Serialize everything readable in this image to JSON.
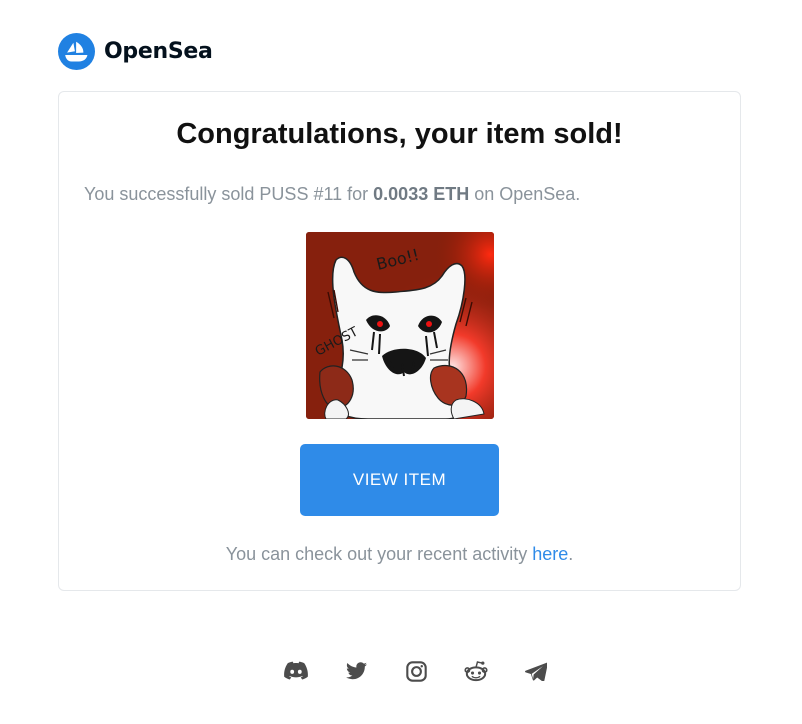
{
  "brand": {
    "name": "OpenSea",
    "accent_color": "#2081e2",
    "icon": "opensea-logo-icon"
  },
  "card": {
    "title": "Congratulations, your item sold!",
    "message": {
      "prefix": "You successfully sold PUSS #11 for ",
      "price": "0.0033 ETH",
      "suffix": " on OpenSea."
    },
    "item_image": {
      "icon": "nft-artwork-image",
      "art_text_1": "Boo!!",
      "art_text_2": "GHOST"
    },
    "view_button_label": "VIEW ITEM",
    "activity": {
      "prefix": "You can check out your recent activity ",
      "link_label": "here",
      "suffix": "."
    }
  },
  "footer": {
    "social_icons": [
      "discord-icon",
      "twitter-icon",
      "instagram-icon",
      "reddit-icon",
      "telegram-icon"
    ]
  },
  "colors": {
    "button": "#2f8be8",
    "link": "#2f8be8",
    "muted_text": "#8a939b",
    "border": "#e5e8eb"
  }
}
